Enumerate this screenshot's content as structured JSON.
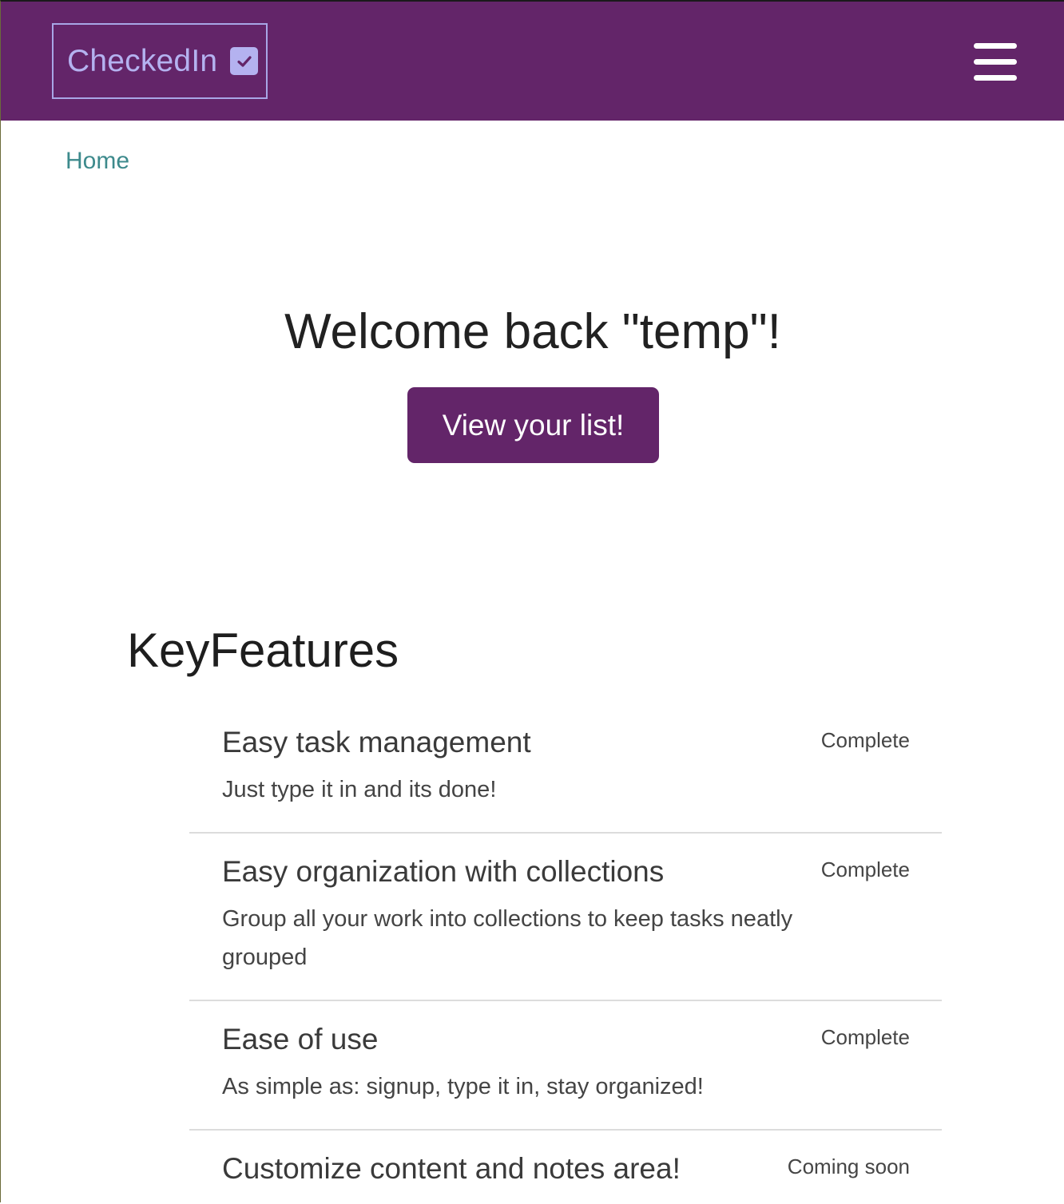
{
  "navbar": {
    "brand_label": "CheckedIn",
    "brand_icon": "checkbox-checked-icon",
    "menu_icon": "hamburger-menu-icon",
    "background_color": "#632569",
    "brand_color": "#b4b2f0"
  },
  "breadcrumb": {
    "home_label": "Home"
  },
  "hero": {
    "welcome_text": "Welcome back \"temp\"!",
    "view_button_label": "View your list!"
  },
  "features": {
    "heading": "KeyFeatures",
    "items": [
      {
        "title": "Easy task management",
        "description": "Just type it in and its done!",
        "status": "Complete"
      },
      {
        "title": "Easy organization with collections",
        "description": "Group all your work into collections to keep tasks neatly grouped",
        "status": "Complete"
      },
      {
        "title": "Ease of use",
        "description": "As simple as: signup, type it in, stay organized!",
        "status": "Complete"
      },
      {
        "title": "Customize content and notes area!",
        "description": "",
        "status": "Coming soon"
      }
    ]
  }
}
